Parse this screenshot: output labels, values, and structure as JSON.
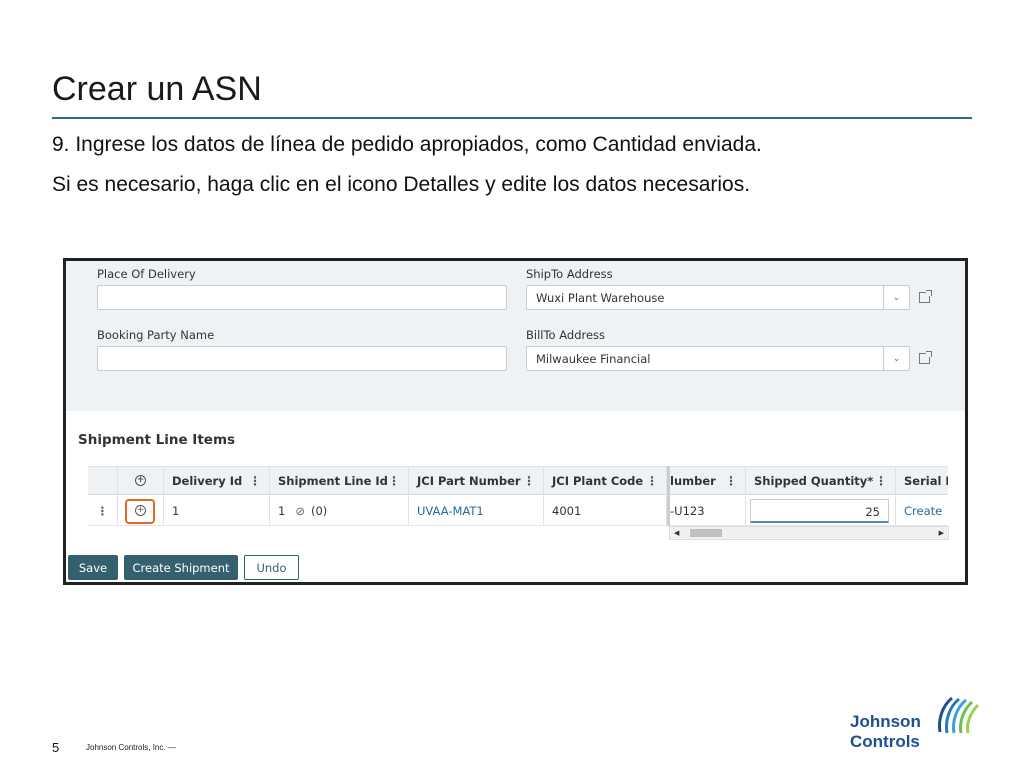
{
  "slide": {
    "title": "Crear un ASN",
    "bullet1": "9. Ingrese los datos de línea de pedido apropiados, como Cantidad enviada.",
    "bullet2": "Si es necesario, haga clic en el icono Detalles y edite los datos necesarios.",
    "page_number": "5",
    "footer": "Johnson Controls, Inc. —",
    "accent_color": "#2e6a8e"
  },
  "form": {
    "place_of_delivery_label": "Place Of Delivery",
    "place_of_delivery_value": "",
    "shipto_label": "ShipTo Address",
    "shipto_value": "Wuxi Plant Warehouse",
    "booking_party_label": "Booking Party Name",
    "booking_party_value": "",
    "billto_label": "BillTo Address",
    "billto_value": "Milwaukee Financial"
  },
  "section_title": "Shipment Line Items",
  "grid": {
    "headers": {
      "details_icon": "plus-circle-icon",
      "delivery_id": "Delivery Id",
      "shipment_line_id": "Shipment Line Id",
      "jci_part_number": "JCI Part Number",
      "jci_plant_code": "JCI Plant Code",
      "number_partial": "lumber",
      "shipped_quantity": "Shipped Quantity*",
      "serial_partial": "Serial N"
    },
    "row": {
      "delivery_id": "1",
      "shipment_line_id": "1",
      "attachments": "(0)",
      "jci_part_number": "UVAA-MAT1",
      "jci_plant_code": "4001",
      "number_partial": "-U123",
      "shipped_quantity": "25",
      "serial_link": "Create"
    }
  },
  "buttons": {
    "save": "Save",
    "create_shipment": "Create Shipment",
    "undo": "Undo"
  },
  "logo": {
    "line1": "Johnson",
    "line2": "Controls",
    "color": "#1d4f91"
  }
}
